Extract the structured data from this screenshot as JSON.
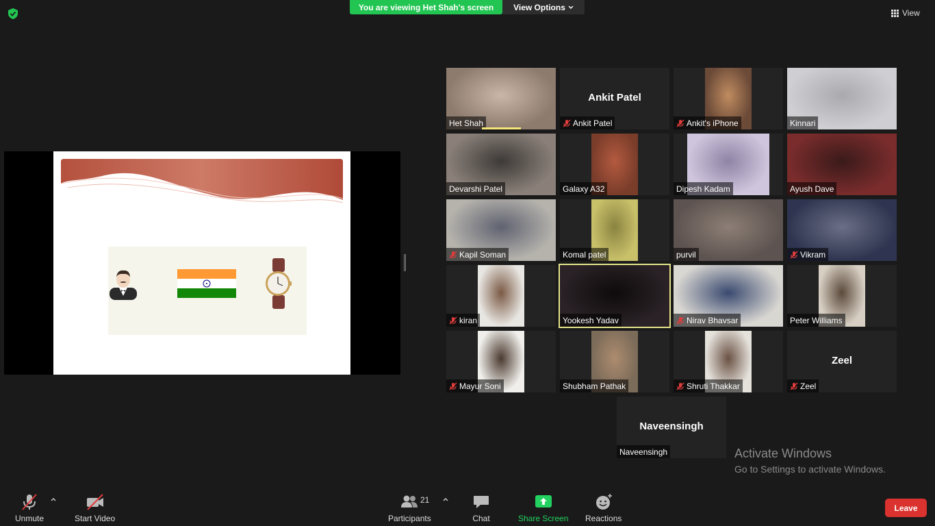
{
  "banner": {
    "viewing_text": "You are viewing Het Shah's screen",
    "view_options_label": "View Options",
    "view_label": "View"
  },
  "participants_tiles": [
    {
      "name": "Het Shah",
      "muted": false,
      "has_video": true,
      "speaking": true
    },
    {
      "name": "Ankit Patel",
      "muted": true,
      "has_video": false,
      "big_name": "Ankit Patel"
    },
    {
      "name": "Ankit's iPhone",
      "muted": true,
      "has_video": true
    },
    {
      "name": "Kinnari",
      "muted": false,
      "has_video": true
    },
    {
      "name": "Devarshi Patel",
      "muted": false,
      "has_video": true
    },
    {
      "name": "Galaxy A32",
      "muted": false,
      "has_video": true
    },
    {
      "name": "Dipesh Kadam",
      "muted": false,
      "has_video": true
    },
    {
      "name": "Ayush Dave",
      "muted": false,
      "has_video": true
    },
    {
      "name": "Kapil Soman",
      "muted": true,
      "has_video": true
    },
    {
      "name": "Komal patel",
      "muted": false,
      "has_video": true
    },
    {
      "name": "purvil",
      "muted": false,
      "has_video": true
    },
    {
      "name": "Vikram",
      "muted": true,
      "has_video": true
    },
    {
      "name": "kiran",
      "muted": true,
      "has_video": true
    },
    {
      "name": "Yookesh Yadav",
      "muted": false,
      "has_video": true,
      "active": true
    },
    {
      "name": "Nirav Bhavsar",
      "muted": true,
      "has_video": true
    },
    {
      "name": "Peter Williams",
      "muted": false,
      "has_video": true
    },
    {
      "name": "Mayur Soni",
      "muted": true,
      "has_video": true
    },
    {
      "name": "Shubham Pathak",
      "muted": false,
      "has_video": true
    },
    {
      "name": "Shruti Thakkar",
      "muted": true,
      "has_video": true
    },
    {
      "name": "Zeel",
      "muted": true,
      "has_video": false,
      "big_name": "Zeel"
    },
    {
      "name": "Naveensingh",
      "muted": false,
      "has_video": false,
      "big_name": "Naveensingh"
    }
  ],
  "watermark": {
    "title": "Activate Windows",
    "subtitle": "Go to Settings to activate Windows."
  },
  "toolbar": {
    "unmute": "Unmute",
    "start_video": "Start Video",
    "participants": "Participants",
    "participants_count": "21",
    "chat": "Chat",
    "share_screen": "Share Screen",
    "reactions": "Reactions",
    "leave": "Leave"
  },
  "colors": {
    "green": "#23c552",
    "leave_red": "#d9322f",
    "active_outline": "#e6e68a",
    "mute_red": "#e03c3c"
  }
}
